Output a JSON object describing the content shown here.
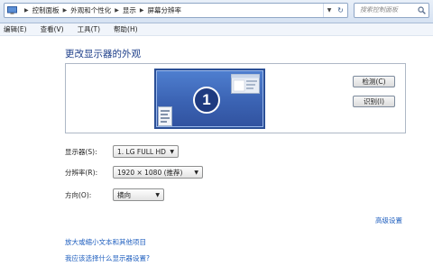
{
  "address_bar": {
    "breadcrumbs": [
      "控制面板",
      "外观和个性化",
      "显示",
      "屏幕分辨率"
    ],
    "search_placeholder": "搜索控制面板"
  },
  "menu": [
    "编辑(E)",
    "查看(V)",
    "工具(T)",
    "帮助(H)"
  ],
  "main": {
    "title": "更改显示器的外观",
    "preview": {
      "monitor_number": "1",
      "detect_button": "检测(C)",
      "identify_button": "识别(I)"
    },
    "fields": {
      "display": {
        "label": "显示器(S):",
        "value": "1. LG FULL HD"
      },
      "resolution": {
        "label": "分辨率(R):",
        "value": "1920 × 1080 (推荐)"
      },
      "orientation": {
        "label": "方向(O):",
        "value": "横向"
      }
    },
    "advanced_link": "高级设置",
    "links": [
      "放大或缩小文本和其他项目",
      "我应该选择什么显示器设置?"
    ]
  },
  "colors": {
    "accent_title": "#1e3f8a",
    "link": "#1f5fbf",
    "monitor_blue": "#3b63b3"
  }
}
